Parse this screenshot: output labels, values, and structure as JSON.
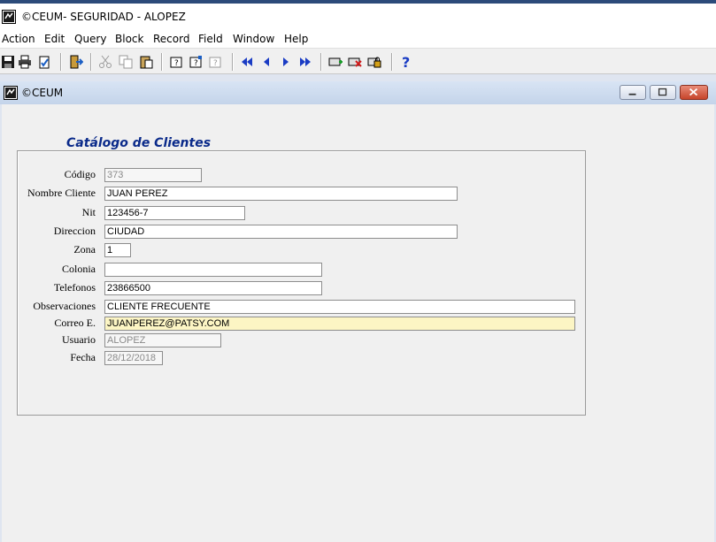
{
  "app": {
    "title": "©CEUM- SEGURIDAD - ALOPEZ"
  },
  "menu": [
    "Action",
    "Edit",
    "Query",
    "Block",
    "Record",
    "Field",
    "Window",
    "Help"
  ],
  "child": {
    "title": "©CEUM"
  },
  "form": {
    "heading": "Catálogo de Clientes",
    "labels": {
      "codigo": "Código",
      "nombre": "Nombre Cliente",
      "nit": "Nit",
      "direccion": "Direccion",
      "zona": "Zona",
      "colonia": "Colonia",
      "telefonos": "Telefonos",
      "observaciones": "Observaciones",
      "correo": "Correo E.",
      "usuario": "Usuario",
      "fecha": "Fecha"
    },
    "values": {
      "codigo": "373",
      "nombre": "JUAN PEREZ",
      "nit": "123456-7",
      "direccion": "CIUDAD",
      "zona": "1",
      "colonia": "",
      "telefonos": "23866500",
      "observaciones": "CLIENTE FRECUENTE",
      "correo": "JUANPEREZ@PATSY.COM",
      "usuario": "ALOPEZ",
      "fecha": "28/12/2018"
    }
  },
  "colors": {
    "heading": "#0a2a8a",
    "active_field": "#fcf5c4",
    "background": "#f0f0f0"
  }
}
